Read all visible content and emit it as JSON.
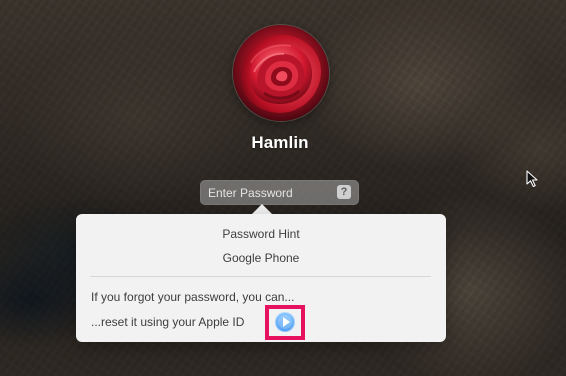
{
  "user": {
    "name": "Hamlin",
    "avatar_icon": "red-rose-avatar"
  },
  "password_field": {
    "placeholder": "Enter Password",
    "help_button_label": "?"
  },
  "password_hint_popover": {
    "title": "Password Hint",
    "hint": "Google Phone",
    "recovery_intro": "If you forgot your password, you can...",
    "recovery_action": "...reset it using your Apple ID"
  },
  "colors": {
    "highlight": "#e6125f",
    "action_blue": "#4e9df2"
  },
  "icons": {
    "reset_action": "circle-arrow-right-icon",
    "cursor": "mouse-pointer-icon"
  }
}
